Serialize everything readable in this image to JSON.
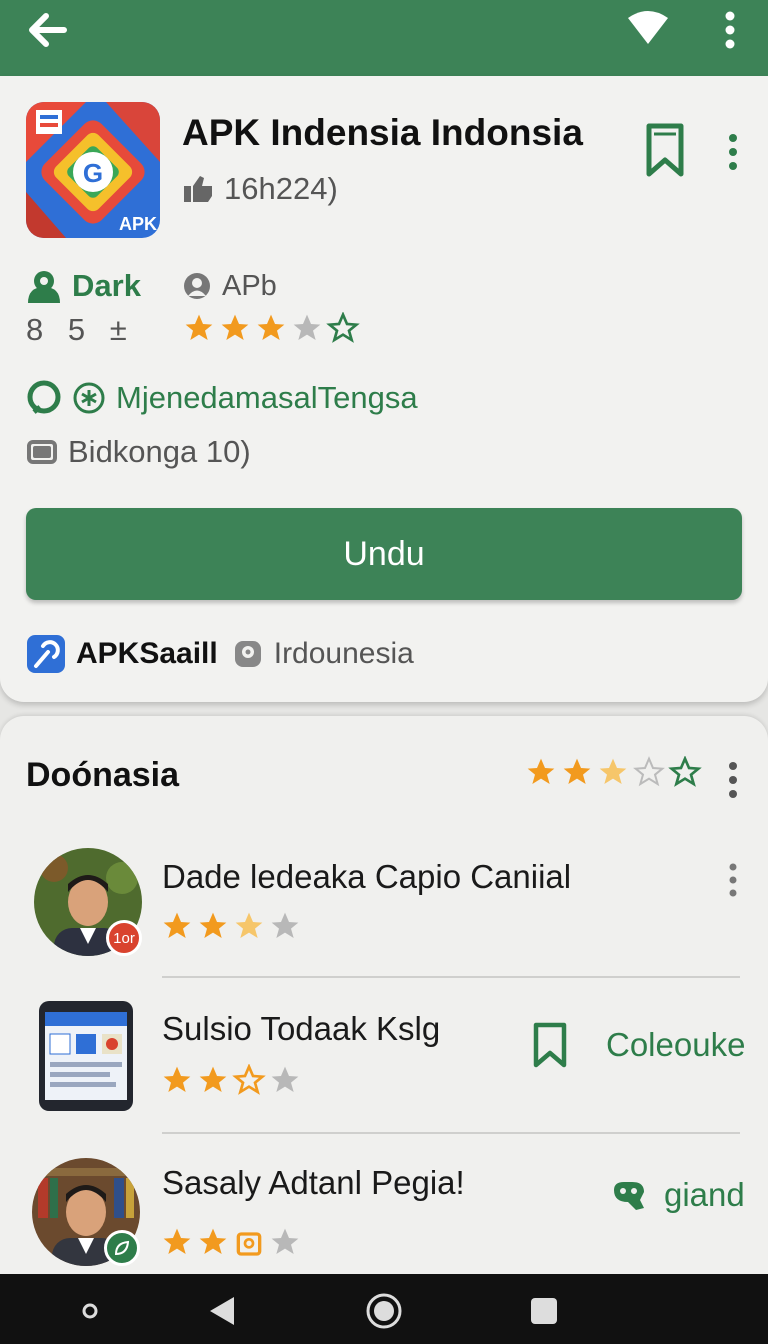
{
  "topbar": {
    "back_icon": "arrow-left-icon",
    "wifi_icon": "wifi-icon",
    "menu_icon": "more-vertical-icon"
  },
  "app": {
    "title": "APK Indensia Indonsia",
    "meta": "16h224)",
    "icon_label": "APK",
    "dev_label": "Dark",
    "apb_label": "APb",
    "stats": "8 5 ±",
    "rating_stars": 3.5,
    "tag_text": "MjenedamasalTengsa",
    "info_text": "Bidkonga 10)",
    "download_label": "Undu",
    "footer_brand": "APKSaaill",
    "footer_region": "Irdounesia"
  },
  "section": {
    "title": "Doónasia",
    "rating_stars": 2.5,
    "items": [
      {
        "title": "Dade ledeaka Capio Caniial",
        "rating": 2.5,
        "badge": "1or",
        "action_label": ""
      },
      {
        "title": "Sulsio Todaak Kslg",
        "rating": 2.5,
        "badge": "",
        "action_label": "Coleouke"
      },
      {
        "title": "Sasaly Adtanl Pegia!",
        "rating": 2.5,
        "badge": "",
        "action_label": "giand"
      }
    ]
  },
  "colors": {
    "primary": "#3d8357",
    "accent_green": "#2e7d4a",
    "star": "#f29a1e",
    "star_empty": "#b8b8b8"
  },
  "navbar": {
    "icons": [
      "home-dot-icon",
      "back-triangle-icon",
      "home-circle-icon",
      "recents-square-icon"
    ]
  }
}
